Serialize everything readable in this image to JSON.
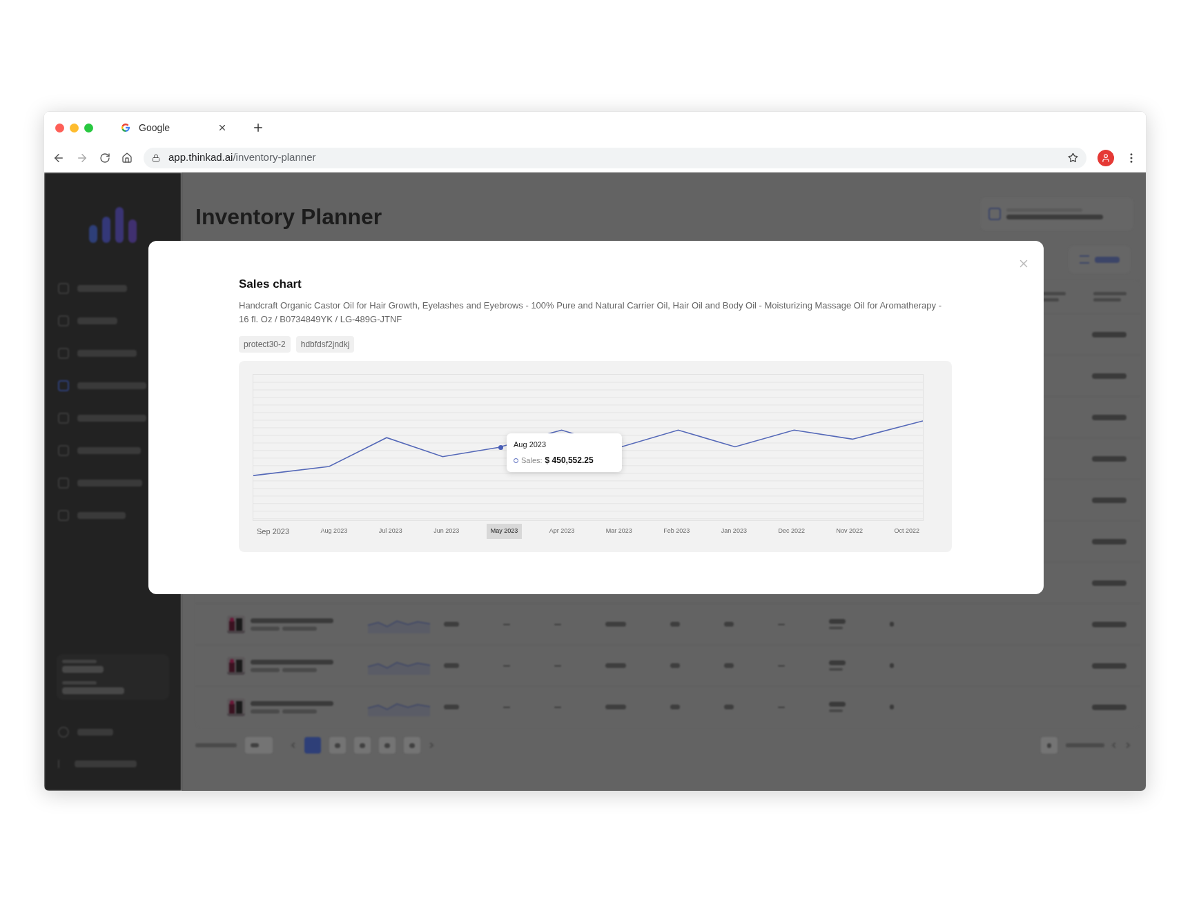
{
  "browser": {
    "tab_title": "Google",
    "url_host": "app.thinkad.ai",
    "url_path": "/inventory-planner"
  },
  "header": {
    "title": "Inventory Planner"
  },
  "modal": {
    "title": "Sales chart",
    "description": "Handcraft Organic Castor Oil for Hair Growth, Eyelashes and Eyebrows - 100% Pure and Natural Carrier Oil, Hair Oil and Body Oil - Moisturizing Massage Oil for Aromatherapy - 16 fl. Oz / B0734849YK / LG-489G-JTNF",
    "tags": [
      "protect30-2",
      "hdbfdsf2jndkj"
    ],
    "x_labels": [
      {
        "label": "Sep 2023",
        "selected": false
      },
      {
        "label": "Aug 2023",
        "selected": false
      },
      {
        "label": "Jul 2023",
        "selected": false
      },
      {
        "label": "Jun 2023",
        "selected": false
      },
      {
        "label": "May 2023",
        "selected": true
      },
      {
        "label": "Apr 2023",
        "selected": false
      },
      {
        "label": "Mar 2023",
        "selected": false
      },
      {
        "label": "Feb 2023",
        "selected": false
      },
      {
        "label": "Jan 2023",
        "selected": false
      },
      {
        "label": "Dec 2022",
        "selected": false
      },
      {
        "label": "Nov 2022",
        "selected": false
      },
      {
        "label": "Oct 2022",
        "selected": false
      }
    ],
    "tooltip": {
      "title": "Aug 2023",
      "label": "Sales:",
      "value": "$ 450,552.25"
    }
  }
}
